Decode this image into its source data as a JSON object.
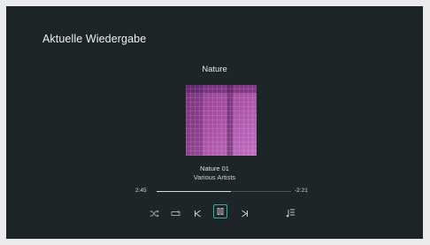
{
  "header": {
    "title": "Aktuelle Wiedergabe"
  },
  "album": {
    "title": "Nature",
    "art_icon": "album-art"
  },
  "track": {
    "title": "Nature 01",
    "artist": "Various Artists"
  },
  "playback": {
    "elapsed": "2:45",
    "remaining": "-2:21",
    "progress_fraction": 0.55,
    "state": "playing"
  },
  "controls": {
    "shuffle_icon": "shuffle-icon",
    "repeat_icon": "repeat-icon",
    "previous_icon": "skip-previous-icon",
    "pause_icon": "pause-icon",
    "next_icon": "skip-next-icon",
    "queue_icon": "queue-icon"
  },
  "colors": {
    "background": "#1d2528",
    "accent": "#3fa6a8",
    "art_primary": "#a94fa4"
  }
}
